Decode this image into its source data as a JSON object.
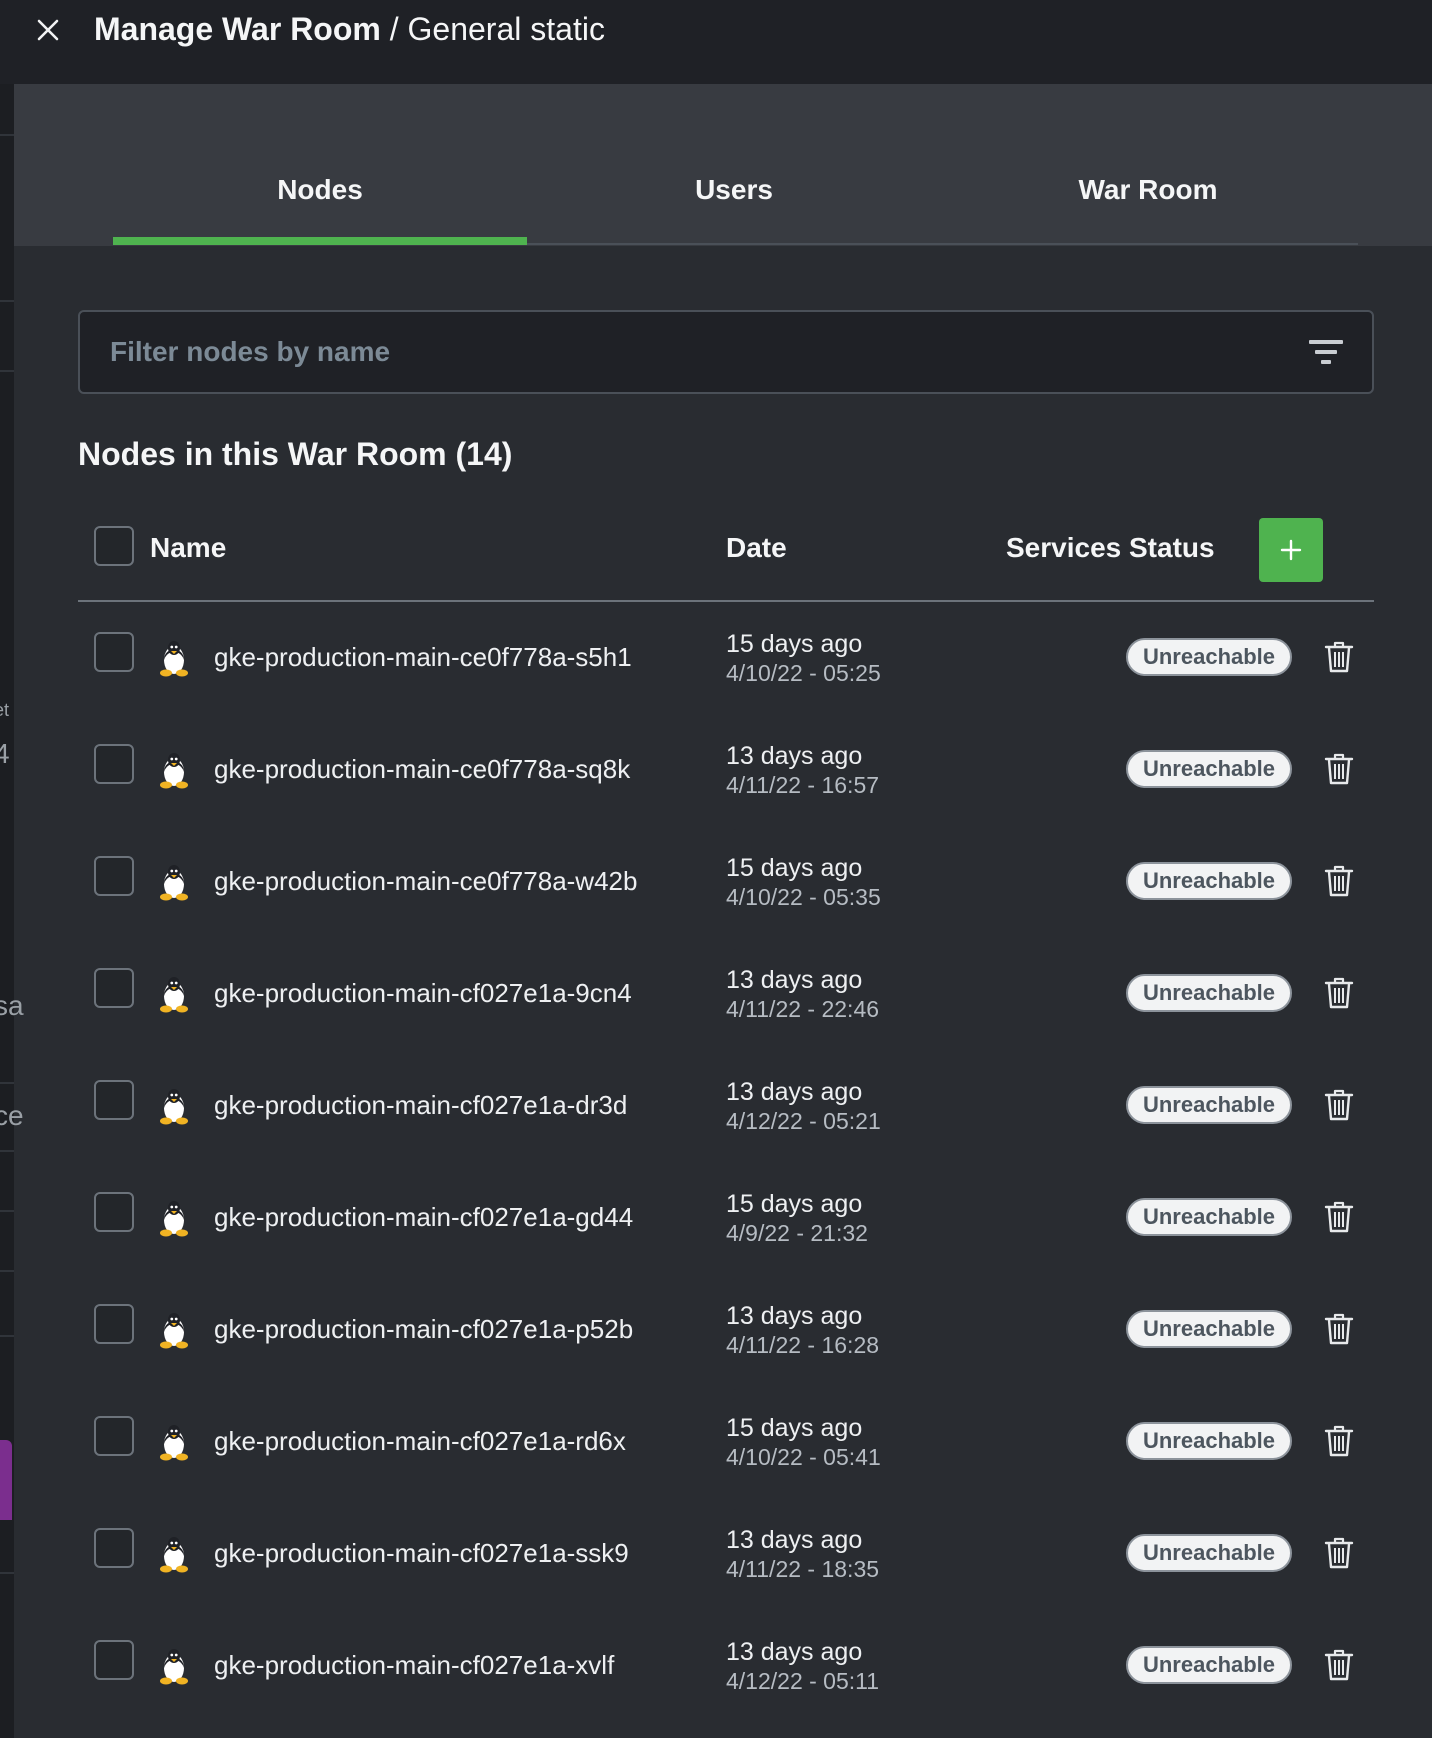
{
  "header": {
    "title_strong": "Manage War Room",
    "title_rest": " / General static"
  },
  "tabs": [
    {
      "label": "Nodes",
      "active": true
    },
    {
      "label": "Users",
      "active": false
    },
    {
      "label": "War Room",
      "active": false
    }
  ],
  "filter": {
    "placeholder": "Filter nodes by name",
    "value": ""
  },
  "section_title": "Nodes in this War Room (14)",
  "table": {
    "columns": [
      "Name",
      "Date",
      "Services Status"
    ],
    "rows": [
      {
        "name": "gke-production-main-ce0f778a-s5h1",
        "relative": "15 days ago",
        "date": "4/10/22 - 05:25",
        "status": "Unreachable"
      },
      {
        "name": "gke-production-main-ce0f778a-sq8k",
        "relative": "13 days ago",
        "date": "4/11/22 - 16:57",
        "status": "Unreachable"
      },
      {
        "name": "gke-production-main-ce0f778a-w42b",
        "relative": "15 days ago",
        "date": "4/10/22 - 05:35",
        "status": "Unreachable"
      },
      {
        "name": "gke-production-main-cf027e1a-9cn4",
        "relative": "13 days ago",
        "date": "4/11/22 - 22:46",
        "status": "Unreachable"
      },
      {
        "name": "gke-production-main-cf027e1a-dr3d",
        "relative": "13 days ago",
        "date": "4/12/22 - 05:21",
        "status": "Unreachable"
      },
      {
        "name": "gke-production-main-cf027e1a-gd44",
        "relative": "15 days ago",
        "date": "4/9/22 - 21:32",
        "status": "Unreachable"
      },
      {
        "name": "gke-production-main-cf027e1a-p52b",
        "relative": "13 days ago",
        "date": "4/11/22 - 16:28",
        "status": "Unreachable"
      },
      {
        "name": "gke-production-main-cf027e1a-rd6x",
        "relative": "15 days ago",
        "date": "4/10/22 - 05:41",
        "status": "Unreachable"
      },
      {
        "name": "gke-production-main-cf027e1a-ssk9",
        "relative": "13 days ago",
        "date": "4/11/22 - 18:35",
        "status": "Unreachable"
      },
      {
        "name": "gke-production-main-cf027e1a-xvlf",
        "relative": "13 days ago",
        "date": "4/12/22 - 05:11",
        "status": "Unreachable"
      }
    ]
  },
  "background_fragments": [
    "et",
    "4",
    "sa",
    "ce"
  ],
  "colors": {
    "accent_green": "#4fb34f",
    "header_bg": "#1f2126",
    "panel_bg": "#292c31",
    "tabs_bg": "#383b41"
  }
}
